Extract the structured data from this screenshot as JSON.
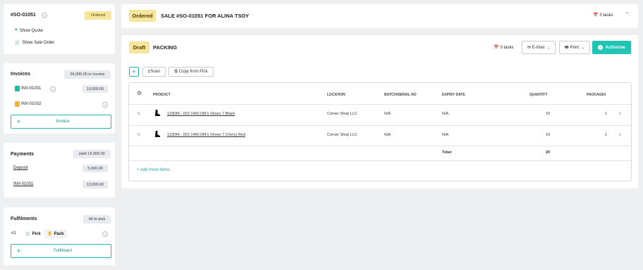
{
  "sidebar": {
    "order": {
      "number": "#SO-01051",
      "status": "Ordered",
      "links": [
        "Show Quote",
        "Show Sale Order"
      ]
    },
    "invoices": {
      "title": "Invoices",
      "summary": "26,000.00 to invoice",
      "items": [
        {
          "label": "INV-01031",
          "amount": "13,000.00"
        },
        {
          "label": "INV-01032",
          "amount": ""
        }
      ],
      "add_label": "Invoice"
    },
    "payments": {
      "title": "Payments",
      "summary": "paid 13,000.00",
      "items": [
        {
          "label": "Deposit",
          "amount": "5,000.00"
        },
        {
          "label": "INV-01031",
          "amount": "13,000.00"
        }
      ]
    },
    "fulfilments": {
      "title": "Fulfilments",
      "summary": "40 to pick",
      "row_number": "#1",
      "pick_label": "Pick",
      "pack_label": "Pack",
      "add_label": "Fulfilment"
    }
  },
  "header": {
    "status": "Ordered",
    "title": "SALE #SO-01051 FOR ALINA TSOY",
    "tasks": "0 tasks"
  },
  "packing": {
    "status": "Draft",
    "title": "PACKING",
    "tasks": "0 tasks",
    "email_label": "E-Mail",
    "print_label": "Print",
    "authorise_label": "Authorise",
    "toolbar": {
      "scan_label": "Scan",
      "copy_label": "Copy from Pick"
    },
    "table": {
      "columns": [
        "PRODUCT",
        "LOCATION",
        "BATCH/SERIAL NO",
        "EXPIRY DATE",
        "QUANTITY",
        "PACKAGE#"
      ],
      "rows": [
        {
          "product": "123DM - 002:1460 DM's Shoes 7 Black",
          "location": "Corner Shop LLC",
          "batch": "N/A",
          "expiry": "N/A",
          "quantity": "10",
          "package": "1"
        },
        {
          "product": "123DM - 001:1460 DM's Shoes 7 Cherry Red",
          "location": "Corner Shop LLC",
          "batch": "N/A",
          "expiry": "N/A",
          "quantity": "10",
          "package": "1"
        }
      ],
      "total_label": "Total:",
      "total_quantity": "20",
      "add_more_label": "+ Add more items"
    }
  },
  "colors": {
    "teal": "#22b8a8",
    "yellow_badge": "#f7e59b",
    "background": "#eeeff1"
  }
}
